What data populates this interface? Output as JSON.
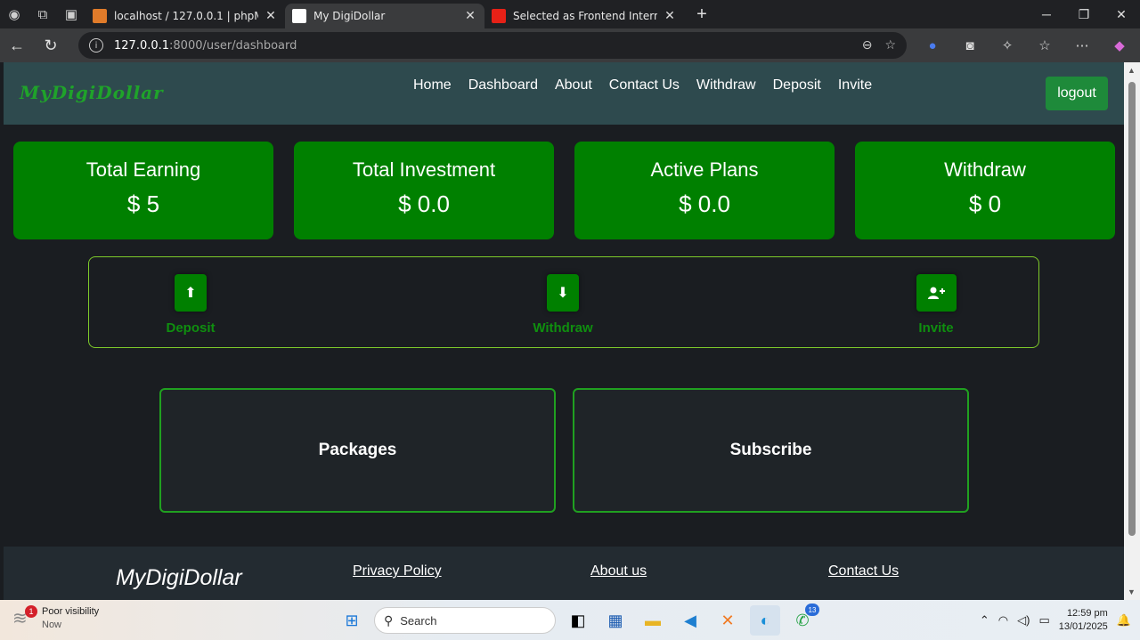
{
  "browser": {
    "tabs": [
      {
        "title": "localhost / 127.0.0.1 | phpMyAdm",
        "favicon_color": "#e07b2a",
        "active": false
      },
      {
        "title": "My DigiDollar",
        "favicon_color": "#ffffff",
        "active": true
      },
      {
        "title": "Selected as Frontend Intern | HTM",
        "favicon_color": "#e62117",
        "active": false
      }
    ],
    "url_host": "127.0.0.1",
    "url_rest": ":8000/user/dashboard"
  },
  "site": {
    "brand": "MyDigiDollar",
    "nav": [
      "Home",
      "Dashboard",
      "About",
      "Contact Us",
      "Withdraw",
      "Deposit",
      "Invite"
    ],
    "logout_label": "logout"
  },
  "stats": [
    {
      "label": "Total Earning",
      "value": "$ 5"
    },
    {
      "label": "Total Investment",
      "value": "$ 0.0"
    },
    {
      "label": "Active Plans",
      "value": "$ 0.0"
    },
    {
      "label": "Withdraw",
      "value": "$ 0"
    }
  ],
  "actions": [
    {
      "label": "Deposit",
      "icon": "arrow-up-icon"
    },
    {
      "label": "Withdraw",
      "icon": "arrow-down-icon"
    },
    {
      "label": "Invite",
      "icon": "user-plus-icon"
    }
  ],
  "cards": [
    "Packages",
    "Subscribe"
  ],
  "footer": {
    "brand": "MyDigiDollar",
    "links": [
      "Privacy Policy",
      "About us",
      "Contact Us"
    ]
  },
  "taskbar": {
    "weather_title": "Poor visibility",
    "weather_sub": "Now",
    "weather_badge": "1",
    "search_placeholder": "Search",
    "whatsapp_badge": "13",
    "time": "12:59 pm",
    "date": "13/01/2025"
  },
  "colors": {
    "stat_green": "#008000",
    "nav_bg": "#2e4a4e",
    "card_border": "#20a020",
    "action_border": "#7ecb2a"
  }
}
